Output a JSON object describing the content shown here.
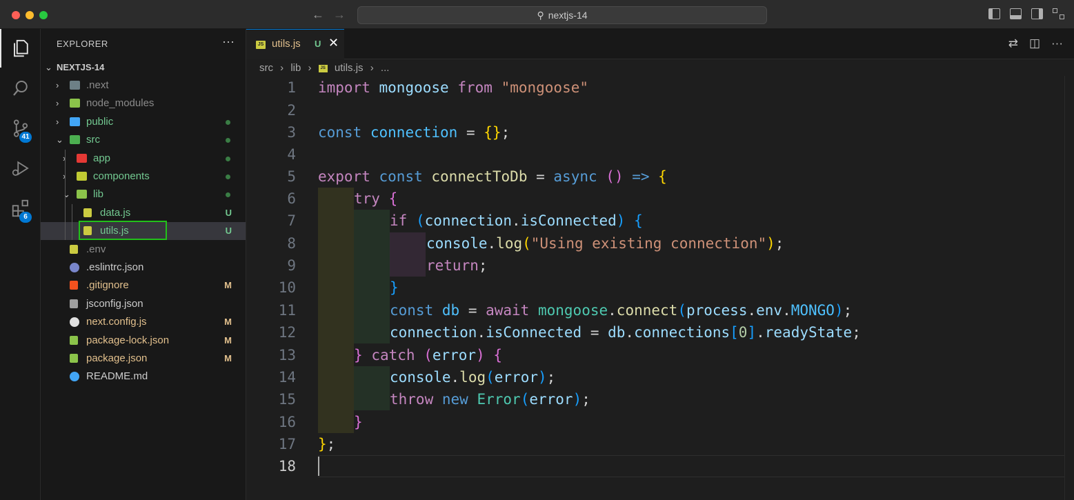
{
  "window": {
    "search_title": "nextjs-14"
  },
  "activity": {
    "scm_badge": "41",
    "extensions_badge": "6"
  },
  "explorer": {
    "title": "EXPLORER",
    "more": "···",
    "root": "NEXTJS-14",
    "items": [
      {
        "label": ".next",
        "color": "#8b8b8b",
        "icon": "folder-next-icon",
        "decoration": ""
      },
      {
        "label": "node_modules",
        "color": "#8b8b8b",
        "icon": "folder-node-icon",
        "decoration": ""
      },
      {
        "label": "public",
        "color": "#73c991",
        "icon": "folder-public-icon",
        "decoration": "dot"
      },
      {
        "label": "src",
        "color": "#73c991",
        "icon": "folder-src-icon",
        "decoration": "dot"
      },
      {
        "label": "app",
        "color": "#73c991",
        "icon": "folder-app-icon",
        "decoration": "dot"
      },
      {
        "label": "components",
        "color": "#73c991",
        "icon": "folder-components-icon",
        "decoration": "dot"
      },
      {
        "label": "lib",
        "color": "#73c991",
        "icon": "folder-lib-icon",
        "decoration": "dot"
      },
      {
        "label": "data.js",
        "color": "#73c991",
        "icon": "js-file-icon",
        "decoration": "U"
      },
      {
        "label": "utils.js",
        "color": "#73c991",
        "icon": "js-file-icon",
        "decoration": "U"
      },
      {
        "label": ".env",
        "color": "#8b8b8b",
        "icon": "env-file-icon",
        "decoration": ""
      },
      {
        "label": ".eslintrc.json",
        "color": "#cccccc",
        "icon": "eslint-file-icon",
        "decoration": ""
      },
      {
        "label": ".gitignore",
        "color": "#e2c08d",
        "icon": "git-file-icon",
        "decoration": "M"
      },
      {
        "label": "jsconfig.json",
        "color": "#cccccc",
        "icon": "json-file-icon",
        "decoration": ""
      },
      {
        "label": "next.config.js",
        "color": "#e2c08d",
        "icon": "next-file-icon",
        "decoration": "M"
      },
      {
        "label": "package-lock.json",
        "color": "#e2c08d",
        "icon": "npm-file-icon",
        "decoration": "M"
      },
      {
        "label": "package.json",
        "color": "#e2c08d",
        "icon": "npm-file-icon",
        "decoration": "M"
      },
      {
        "label": "README.md",
        "color": "#cccccc",
        "icon": "info-file-icon",
        "decoration": ""
      }
    ]
  },
  "tab": {
    "js_badge": "JS",
    "name": "utils.js",
    "status": "U",
    "close": "✕"
  },
  "breadcrumb": {
    "parts": [
      "src",
      "lib",
      "utils.js",
      "..."
    ],
    "sep": "›"
  },
  "code": {
    "line_numbers": [
      "1",
      "2",
      "3",
      "4",
      "5",
      "6",
      "7",
      "8",
      "9",
      "10",
      "11",
      "12",
      "13",
      "14",
      "15",
      "16",
      "17",
      "18"
    ],
    "current_line": "18",
    "t": {
      "import": "import",
      "mongoose": "mongoose",
      "from": "from",
      "mongoose_str": "\"mongoose\"",
      "const": "const",
      "connection": "connection",
      "eq": " = ",
      "lbrace": "{",
      "rbrace": "}",
      "semi": ";",
      "export": "export",
      "connectToDb": "connectToDb",
      "async": "async",
      "lparen": "(",
      "rparen": ")",
      "arrow": " => ",
      "try": "try",
      "if": "if",
      "dot": ".",
      "isConnected": "isConnected",
      "console": "console",
      "log": "log",
      "using_str": "\"Using existing connection\"",
      "return": "return",
      "db": "db",
      "await": "await",
      "connect": "connect",
      "process": "process",
      "env": "env",
      "MONGO": "MONGO",
      "connections": "connections",
      "lbrack": "[",
      "zero": "0",
      "rbrack": "]",
      "readyState": "readyState",
      "catch": "catch",
      "error": "error",
      "throw": "throw",
      "new": "new",
      "Error": "Error"
    }
  }
}
